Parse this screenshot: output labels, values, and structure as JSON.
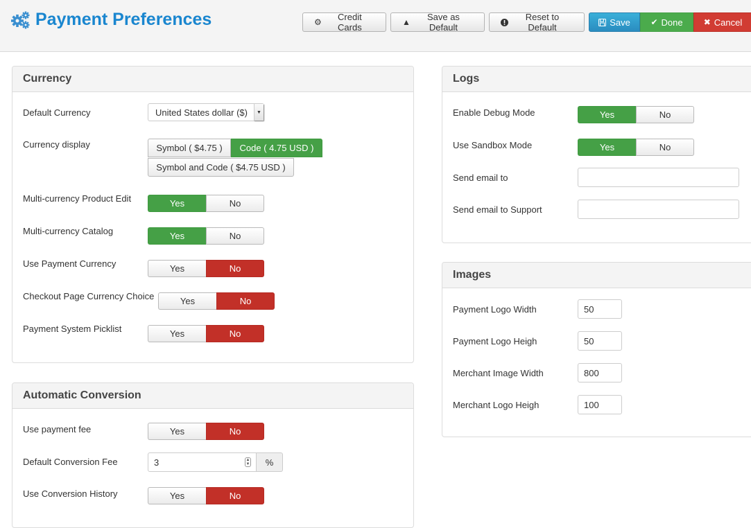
{
  "header": {
    "title": "Payment Preferences",
    "title_icon": "gears-icon",
    "toolbar": {
      "credit_cards": "Credit Cards",
      "save_as_default": "Save as Default",
      "reset_to_default": "Reset to Default",
      "save": "Save",
      "done": "Done",
      "cancel": "Cancel"
    }
  },
  "colors": {
    "title": "#1a86cf",
    "yes_active": "#45a046",
    "no_active": "#c23028",
    "save": "#2f9bcf",
    "done": "#4bab4c",
    "cancel": "#d13c33"
  },
  "currency": {
    "title": "Currency",
    "default_currency": {
      "label": "Default Currency",
      "value": "United States dollar ($)"
    },
    "currency_display": {
      "label": "Currency display",
      "options": [
        "Symbol ( $4.75 )",
        "Code ( 4.75 USD )",
        "Symbol and Code ( $4.75 USD )"
      ],
      "selected": "Code ( 4.75 USD )"
    },
    "toggles": [
      {
        "label": "Multi-currency Product Edit",
        "yes": "Yes",
        "no": "No",
        "value": "Yes"
      },
      {
        "label": "Multi-currency Catalog",
        "yes": "Yes",
        "no": "No",
        "value": "Yes"
      },
      {
        "label": "Use Payment Currency",
        "yes": "Yes",
        "no": "No",
        "value": "No"
      },
      {
        "label": "Checkout Page Currency Choice",
        "yes": "Yes",
        "no": "No",
        "value": "No"
      },
      {
        "label": "Payment System Picklist",
        "yes": "Yes",
        "no": "No",
        "value": "No"
      }
    ]
  },
  "conversion": {
    "title": "Automatic Conversion",
    "use_payment_fee": {
      "label": "Use payment fee",
      "yes": "Yes",
      "no": "No",
      "value": "No"
    },
    "default_fee": {
      "label": "Default Conversion Fee",
      "value": "3",
      "unit": "%"
    },
    "use_history": {
      "label": "Use Conversion History",
      "yes": "Yes",
      "no": "No",
      "value": "No"
    }
  },
  "logs": {
    "title": "Logs",
    "debug": {
      "label": "Enable Debug Mode",
      "yes": "Yes",
      "no": "No",
      "value": "Yes"
    },
    "sandbox": {
      "label": "Use Sandbox Mode",
      "yes": "Yes",
      "no": "No",
      "value": "Yes"
    },
    "email": {
      "label": "Send email to",
      "value": ""
    },
    "email_support": {
      "label": "Send email to Support",
      "value": ""
    }
  },
  "images": {
    "title": "Images",
    "fields": [
      {
        "label": "Payment Logo Width",
        "value": "50"
      },
      {
        "label": "Payment Logo Heigh",
        "value": "50"
      },
      {
        "label": "Merchant Image Width",
        "value": "800"
      },
      {
        "label": "Merchant Logo Heigh",
        "value": "100"
      }
    ]
  }
}
